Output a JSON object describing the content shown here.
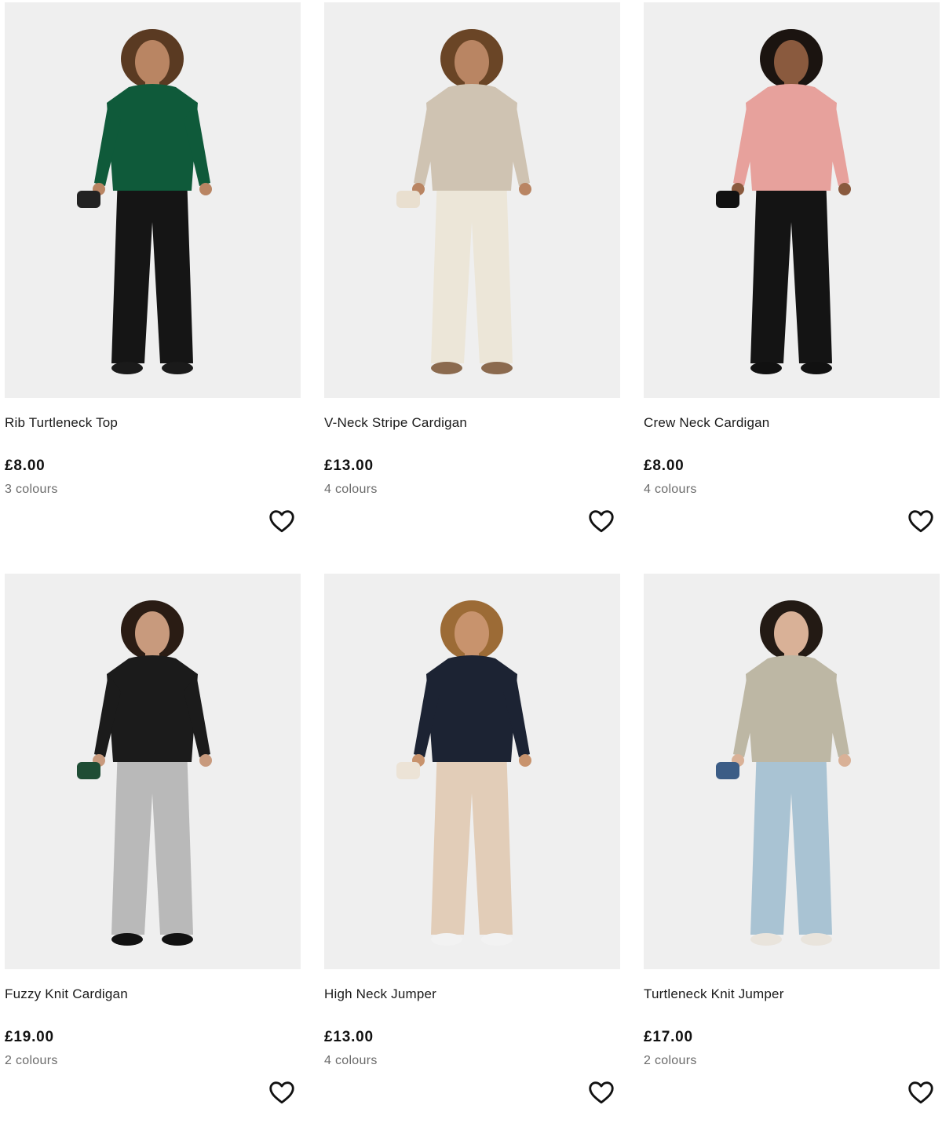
{
  "products": [
    {
      "name": "Rib Turtleneck Top",
      "price": "£8.00",
      "colours": "3 colours",
      "image_icon": "model-photo",
      "palette": {
        "top": "#0f5a3a",
        "bottom": "#151515",
        "skin": "#b98563",
        "hair": "#5a3a22",
        "shoes": "#1a1a1a",
        "accent": "#222222"
      }
    },
    {
      "name": "V-Neck Stripe Cardigan",
      "price": "£13.00",
      "colours": "4 colours",
      "image_icon": "model-photo",
      "palette": {
        "top": "#cfc3b2",
        "bottom": "#ece6d8",
        "skin": "#b98563",
        "hair": "#6a4526",
        "shoes": "#8b6a4e",
        "accent": "#e9dfcf"
      }
    },
    {
      "name": "Crew Neck Cardigan",
      "price": "£8.00",
      "colours": "4 colours",
      "image_icon": "model-photo",
      "palette": {
        "top": "#e7a19c",
        "bottom": "#141414",
        "skin": "#8a5a3e",
        "hair": "#1b1410",
        "shoes": "#111111",
        "accent": "#111111"
      }
    },
    {
      "name": "Fuzzy Knit Cardigan",
      "price": "£19.00",
      "colours": "2 colours",
      "image_icon": "model-photo",
      "palette": {
        "top": "#1b1b1b",
        "bottom": "#b9b9b9",
        "skin": "#c89a7d",
        "hair": "#2a1c14",
        "shoes": "#111111",
        "accent": "#1f4d35"
      }
    },
    {
      "name": "High Neck Jumper",
      "price": "£13.00",
      "colours": "4 colours",
      "image_icon": "model-photo",
      "palette": {
        "top": "#1c2333",
        "bottom": "#e2cdb8",
        "skin": "#c8936d",
        "hair": "#9c6b36",
        "shoes": "#f2f2f2",
        "accent": "#ece3d6"
      }
    },
    {
      "name": "Turtleneck Knit Jumper",
      "price": "£17.00",
      "colours": "2 colours",
      "image_icon": "model-photo",
      "palette": {
        "top": "#bdb7a4",
        "bottom": "#a9c3d3",
        "skin": "#d9b197",
        "hair": "#231a14",
        "shoes": "#e9e4dc",
        "accent": "#3c5d86"
      }
    }
  ],
  "wishlist_icon": "heart-outline-icon",
  "colors": {
    "image_bg": "#efefef",
    "text": "#111111",
    "muted": "#6b6b6b"
  }
}
